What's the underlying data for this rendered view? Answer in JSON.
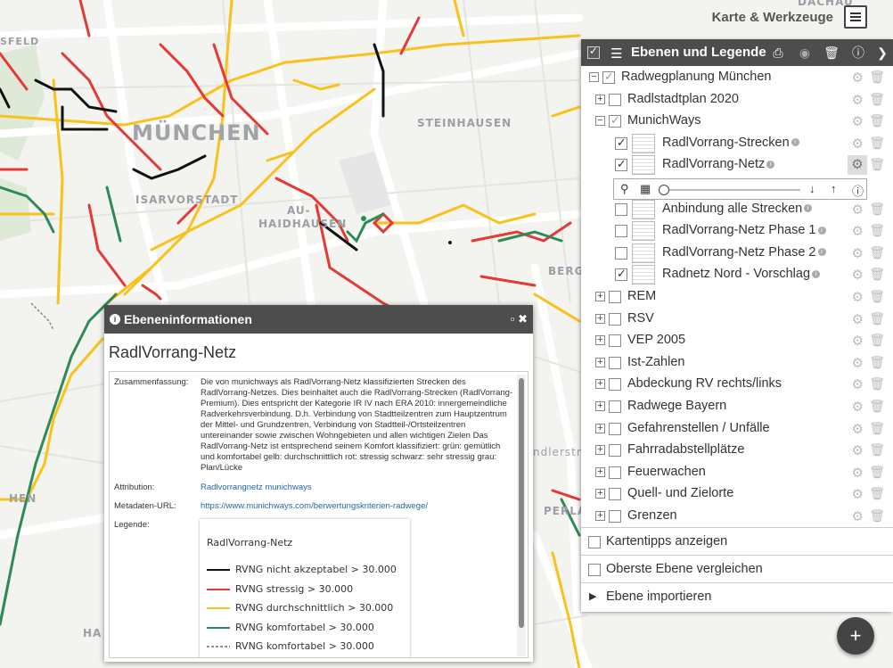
{
  "map": {
    "labels": [
      "DACHAU",
      "MÜNCHEN",
      "ISARVORSTADT",
      "STEINHAUSEN",
      "AU-",
      "HAIDHAUSEN",
      "BERG",
      "ndlerstra",
      "PERLA",
      "HEN",
      "HA",
      "SFELD"
    ],
    "colors": {
      "black": "#111111",
      "red": "#e53935",
      "yellow": "#f9c21b",
      "green": "#2e8b57",
      "gray": "#888888",
      "road": "#ffffff"
    }
  },
  "topbar": {
    "title": "Karte & Werkzeuge",
    "menu_icon": "hamburger-icon"
  },
  "panel": {
    "title": "Ebenen und Legende",
    "header_icons": [
      "print-icon",
      "eye-icon",
      "trash-icon",
      "info-icon"
    ],
    "rows": [
      {
        "label": "Radwegplanung München",
        "expanded": true,
        "checked": true,
        "gray": true,
        "level": 0
      },
      {
        "label": "Radlstadtplan 2020",
        "expanded": false,
        "checked": false,
        "level": 1
      },
      {
        "label": "MunichWays",
        "expanded": true,
        "checked": true,
        "gray": true,
        "level": 1
      },
      {
        "label": "RadlVorrang-Strecken",
        "checked": true,
        "level": 2,
        "thumb": true,
        "info": true
      },
      {
        "label": "RadlVorrang-Netz",
        "checked": true,
        "level": 2,
        "thumb": true,
        "info": true,
        "active": true
      },
      {
        "label": "Anbindung alle Strecken",
        "checked": false,
        "level": 2,
        "thumb": true,
        "info": true
      },
      {
        "label": "RadlVorrang-Netz Phase 1",
        "checked": false,
        "level": 2,
        "thumb": true,
        "info": true
      },
      {
        "label": "RadlVorrang-Netz Phase 2",
        "checked": false,
        "level": 2,
        "thumb": true,
        "info": true
      },
      {
        "label": "Radnetz Nord - Vorschlag",
        "checked": true,
        "level": 2,
        "thumb": true,
        "info": true
      },
      {
        "label": "REM",
        "checked": false,
        "level": 1
      },
      {
        "label": "RSV",
        "checked": false,
        "level": 1
      },
      {
        "label": "VEP 2005",
        "checked": false,
        "level": 1
      },
      {
        "label": "Ist-Zahlen",
        "checked": false,
        "level": 1
      },
      {
        "label": "Abdeckung RV rechts/links",
        "checked": false,
        "level": 1
      },
      {
        "label": "Radwege Bayern",
        "checked": false,
        "level": 1
      },
      {
        "label": "Gefahrenstellen / Unfälle",
        "checked": false,
        "level": 1
      },
      {
        "label": "Fahrradabstellplätze",
        "checked": false,
        "level": 1
      },
      {
        "label": "Feuerwachen",
        "checked": false,
        "level": 1
      },
      {
        "label": "Quell- und Zielorte",
        "checked": false,
        "level": 1
      },
      {
        "label": "Grenzen",
        "checked": false,
        "level": 1
      }
    ],
    "tools": [
      "search-icon",
      "opacity-icon",
      "arrow-down-icon",
      "arrow-up-icon",
      "info-icon"
    ],
    "opacity": 0.0,
    "bottom": {
      "tips": "Kartentipps anzeigen",
      "compare": "Oberste Ebene vergleichen",
      "import": "Ebene importieren"
    }
  },
  "dialog": {
    "title": "Ebeneninformationen",
    "layer_name": "RadlVorrang-Netz",
    "summary_label": "Zusammenfassung:",
    "summary": "Die von munichways als RadlVorrang-Netz klassifizierten Strecken des RadlVorrang-Netzes. Dies beinhaltet auch die RadlVorrang-Strecken (RadlVorrang-Premium). Dies entspricht der Kategorie IR IV nach ERA 2010: innergemeindliche Radverkehrsverbindung. D.h. Verbindung von Stadtteilzentren zum Hauptzentrum der Mittel- und Grundzentren, Verbindung von Stadtteil-/Ortsteilzentren untereinander sowie zwischen Wohngebieten und allen wichtigen Zielen Das RadlVorrang-Netz ist entsprechend seinem Komfort klassifiziert: grün: gemütlich und komfortabel gelb: durchschnittlich rot: stressig schwarz: sehr stressig grau: Plan/Lücke",
    "attribution_label": "Attribution:",
    "attribution": "Radlvorrangnetz munichways",
    "metadata_label": "Metadaten-URL:",
    "metadata_url": "https://www.munichways.com/berwertungskriterien-radwege/",
    "legend_label": "Legende:",
    "legend": {
      "title": "RadlVorrang-Netz",
      "items": [
        {
          "label": "RVNG nicht akzeptabel > 30.000",
          "color": "#111111",
          "dashed": false
        },
        {
          "label": "RVNG stressig > 30.000",
          "color": "#e53935",
          "dashed": false
        },
        {
          "label": "RVNG durchschnittlich > 30.000",
          "color": "#f9c21b",
          "dashed": false
        },
        {
          "label": "RVNG komfortabel  > 30.000",
          "color": "#2e8b57",
          "dashed": false
        },
        {
          "label": "RVNG komfortabel  > 30.000",
          "color": "#8a8fa0",
          "dashed": true
        }
      ]
    }
  },
  "fab": {
    "icon": "plus-icon"
  }
}
